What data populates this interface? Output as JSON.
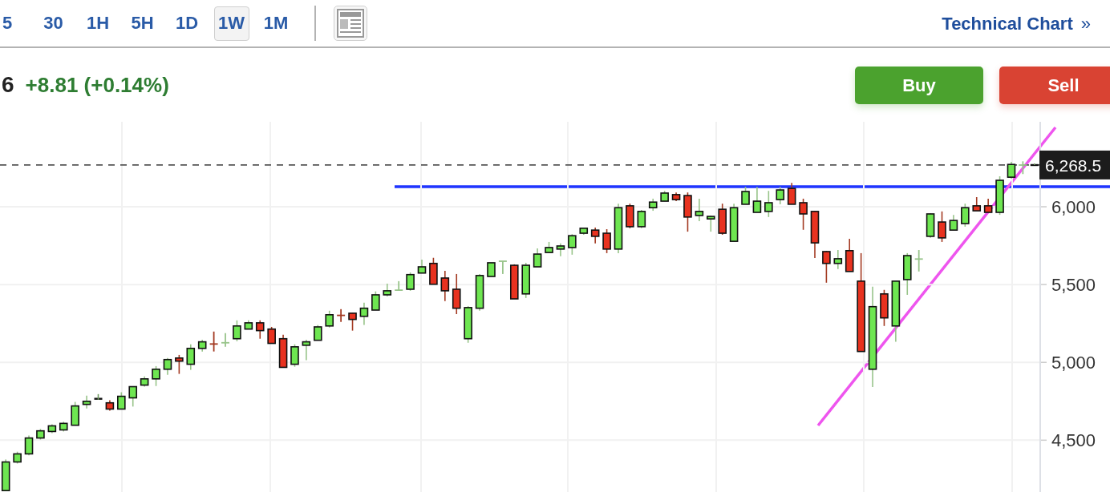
{
  "toolbar": {
    "intervals": [
      {
        "label": "5",
        "selected": false
      },
      {
        "label": "30",
        "selected": false
      },
      {
        "label": "1H",
        "selected": false
      },
      {
        "label": "5H",
        "selected": false
      },
      {
        "label": "1D",
        "selected": false
      },
      {
        "label": "1W",
        "selected": true
      },
      {
        "label": "1M",
        "selected": false
      }
    ],
    "technical_chart_link": {
      "label": "Technical Chart",
      "arrow": "»"
    }
  },
  "quote": {
    "price": "6",
    "change": "+8.81 (+0.14%)"
  },
  "actions": [
    {
      "label": "Buy",
      "kind": "buy"
    },
    {
      "label": "Sell",
      "kind": "sell"
    }
  ],
  "chart": {
    "chart_data": {
      "type": "candlestick",
      "grid": true,
      "ylim": [
        4167,
        6546
      ],
      "ref_lines": [
        {
          "axis": "y",
          "value": 6268.5,
          "label": "6,268.5"
        }
      ],
      "yticks": [
        {
          "value": 4500,
          "label": "4,500"
        },
        {
          "value": 5000,
          "label": "5,000"
        },
        {
          "value": 5500,
          "label": "5,500"
        },
        {
          "value": 6000,
          "label": "6,000"
        }
      ],
      "ohlc": [
        [
          4176,
          4376,
          4176,
          4360
        ],
        [
          4360,
          4426,
          4350,
          4412
        ],
        [
          4412,
          4530,
          4402,
          4514
        ],
        [
          4514,
          4572,
          4504,
          4560
        ],
        [
          4556,
          4602,
          4546,
          4592
        ],
        [
          4566,
          4618,
          4556,
          4608
        ],
        [
          4596,
          4746,
          4596,
          4720
        ],
        [
          4730,
          4786,
          4704,
          4750
        ],
        [
          4766,
          4796,
          4760,
          4766
        ],
        [
          4740,
          4756,
          4690,
          4700
        ],
        [
          4700,
          4808,
          4700,
          4782
        ],
        [
          4772,
          4844,
          4716,
          4844
        ],
        [
          4854,
          4910,
          4844,
          4894
        ],
        [
          4894,
          4976,
          4848,
          4956
        ],
        [
          4956,
          5028,
          4920,
          5018
        ],
        [
          5028,
          5048,
          4926,
          5008
        ],
        [
          4988,
          5116,
          4952,
          5090
        ],
        [
          5090,
          5146,
          5070,
          5132
        ],
        [
          5126,
          5198,
          5070,
          5118
        ],
        [
          5118,
          5188,
          5100,
          5126
        ],
        [
          5152,
          5270,
          5136,
          5234
        ],
        [
          5214,
          5270,
          5214,
          5254
        ],
        [
          5254,
          5270,
          5152,
          5204
        ],
        [
          5214,
          5228,
          5120,
          5122
        ],
        [
          5152,
          5178,
          4968,
          4968
        ],
        [
          4988,
          5116,
          4972,
          5100
        ],
        [
          5110,
          5146,
          5014,
          5132
        ],
        [
          5142,
          5240,
          5142,
          5228
        ],
        [
          5234,
          5332,
          5224,
          5306
        ],
        [
          5310,
          5342,
          5260,
          5302
        ],
        [
          5316,
          5320,
          5204,
          5276
        ],
        [
          5296,
          5384,
          5240,
          5348
        ],
        [
          5336,
          5456,
          5336,
          5434
        ],
        [
          5434,
          5506,
          5424,
          5460
        ],
        [
          5460,
          5522,
          5460,
          5464
        ],
        [
          5470,
          5578,
          5460,
          5564
        ],
        [
          5574,
          5660,
          5574,
          5614
        ],
        [
          5636,
          5672,
          5502,
          5502
        ],
        [
          5542,
          5588,
          5394,
          5460
        ],
        [
          5470,
          5568,
          5310,
          5348
        ],
        [
          5152,
          5362,
          5126,
          5352
        ],
        [
          5348,
          5568,
          5332,
          5558
        ],
        [
          5552,
          5640,
          5552,
          5640
        ],
        [
          5644,
          5650,
          5568,
          5650
        ],
        [
          5624,
          5630,
          5408,
          5408
        ],
        [
          5440,
          5640,
          5414,
          5624
        ],
        [
          5614,
          5732,
          5614,
          5696
        ],
        [
          5706,
          5774,
          5706,
          5738
        ],
        [
          5728,
          5764,
          5682,
          5748
        ],
        [
          5738,
          5824,
          5692,
          5814
        ],
        [
          5830,
          5862,
          5820,
          5862
        ],
        [
          5850,
          5866,
          5764,
          5810
        ],
        [
          5830,
          5856,
          5702,
          5728
        ],
        [
          5728,
          6020,
          5702,
          5994
        ],
        [
          6006,
          6020,
          5862,
          5872
        ],
        [
          5872,
          5980,
          5862,
          5970
        ],
        [
          5994,
          6052,
          5974,
          6030
        ],
        [
          6036,
          6102,
          6036,
          6088
        ],
        [
          6078,
          6092,
          6036,
          6046
        ],
        [
          6072,
          6092,
          5840,
          5934
        ],
        [
          5944,
          6052,
          5908,
          5970
        ],
        [
          5922,
          5944,
          5840,
          5938
        ],
        [
          5984,
          6020,
          5820,
          5830
        ],
        [
          5778,
          6020,
          5778,
          5994
        ],
        [
          6016,
          6128,
          6016,
          6098
        ],
        [
          5964,
          6128,
          5964,
          6036
        ],
        [
          5970,
          6102,
          5934,
          6026
        ],
        [
          6046,
          6128,
          6016,
          6108
        ],
        [
          6118,
          6154,
          6016,
          6016
        ],
        [
          6026,
          6052,
          5852,
          5954
        ],
        [
          5970,
          5974,
          5670,
          5768
        ],
        [
          5712,
          5716,
          5512,
          5636
        ],
        [
          5636,
          5722,
          5600,
          5666
        ],
        [
          5718,
          5794,
          5584,
          5584
        ],
        [
          5522,
          5702,
          5070,
          5070
        ],
        [
          4956,
          5486,
          4842,
          5358
        ],
        [
          5440,
          5466,
          5234,
          5286
        ],
        [
          5234,
          5522,
          5132,
          5522
        ],
        [
          5532,
          5702,
          5434,
          5686
        ],
        [
          5656,
          5722,
          5584,
          5664
        ],
        [
          5810,
          5958,
          5800,
          5954
        ],
        [
          5902,
          5970,
          5774,
          5800
        ],
        [
          5850,
          5948,
          5850,
          5912
        ],
        [
          5892,
          6020,
          5872,
          5994
        ],
        [
          6006,
          6062,
          5974,
          5974
        ],
        [
          6006,
          6052,
          5964,
          5964
        ],
        [
          5964,
          6196,
          5948,
          6170
        ],
        [
          6190,
          6288,
          6180,
          6272
        ],
        [
          6262,
          6292,
          6210,
          6268
        ],
        [
          6268,
          6278,
          6268,
          6268
        ]
      ]
    }
  }
}
